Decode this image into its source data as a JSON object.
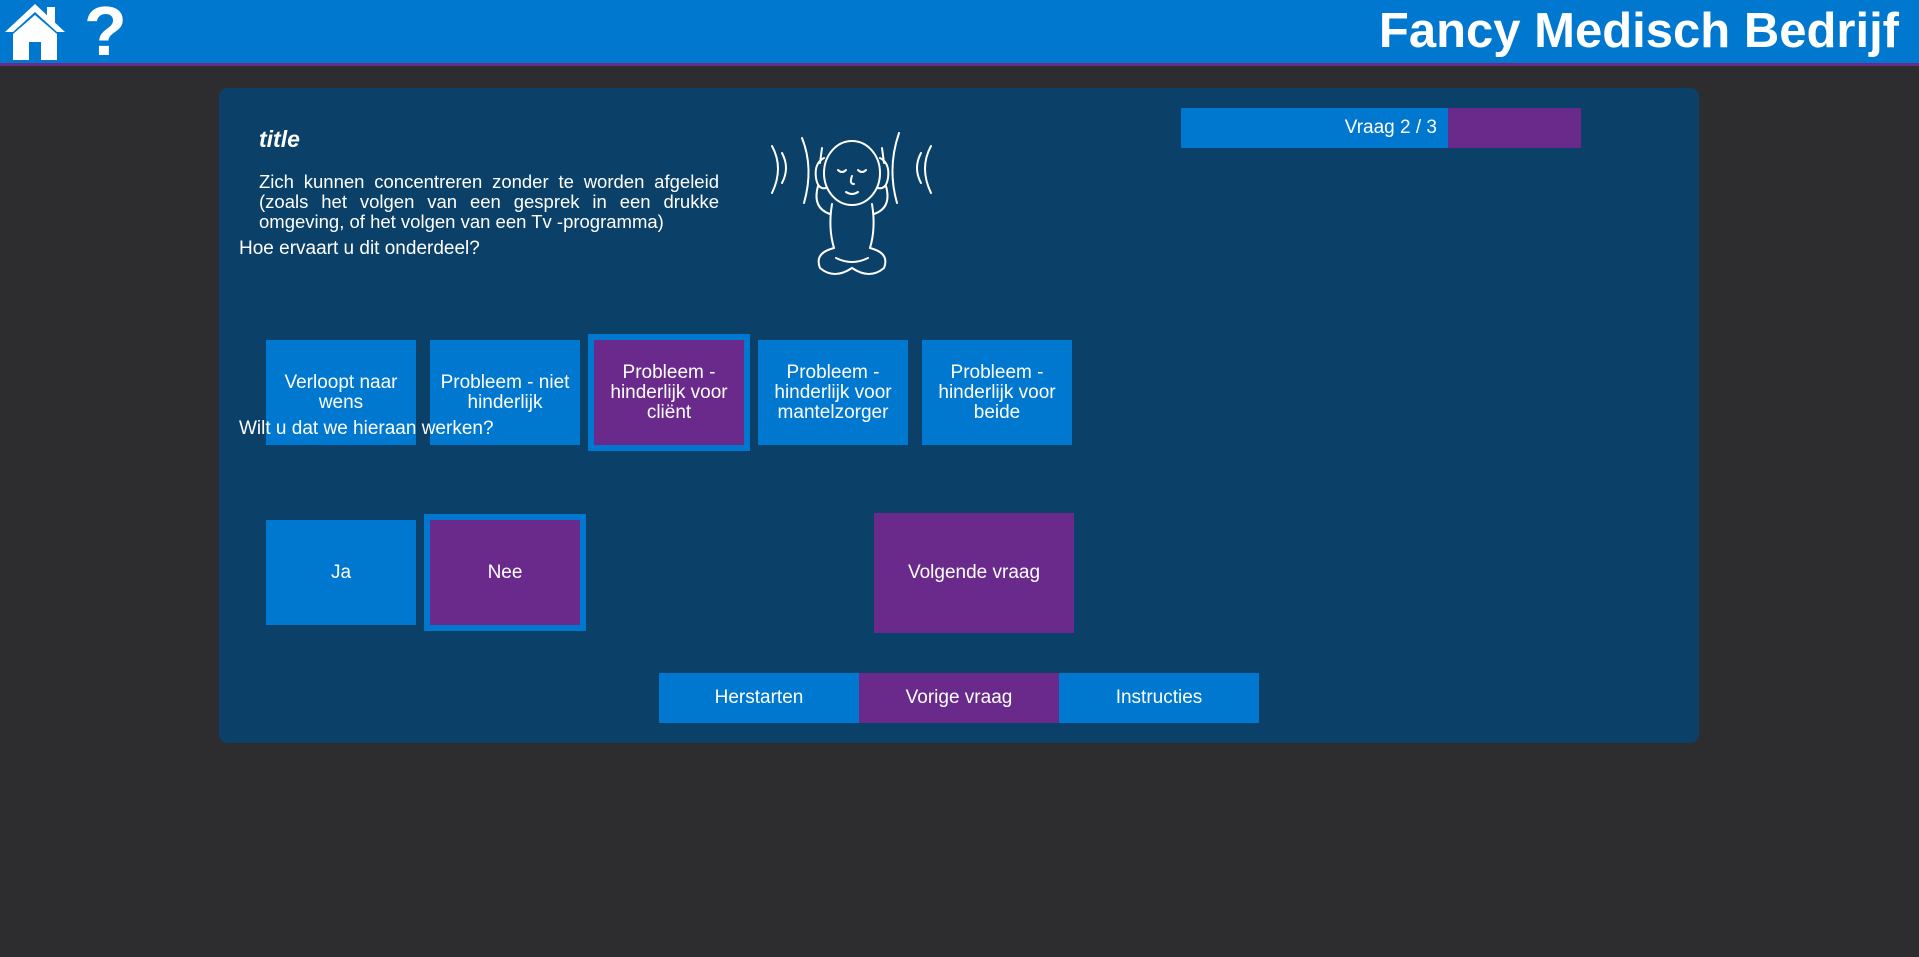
{
  "header": {
    "brand": "Fancy Medisch Bedrijf",
    "help_glyph": "?",
    "home_icon": "home-icon",
    "help_icon": "question-mark-icon",
    "colors": {
      "bar": "#0078d0",
      "underline": "#6a2a8c"
    }
  },
  "progress": {
    "label": "Vraag 2 / 3",
    "current": 2,
    "total": 3,
    "fraction": 0.667
  },
  "question": {
    "title": "title",
    "description": "Zich kunnen concentreren zonder te worden afgeleid (zoals het volgen van een gesprek in een drukke omgeving, of het volgen van een Tv -programma)",
    "illustration": "person-covering-ears-illustration"
  },
  "experience": {
    "label": "Hoe ervaart u dit onderdeel?",
    "options": [
      {
        "label": "Verloopt naar wens",
        "selected": false
      },
      {
        "label": "Probleem - niet hinderlijk",
        "selected": false
      },
      {
        "label": "Probleem - hinderlijk voor cliënt",
        "selected": true
      },
      {
        "label": "Probleem - hinderlijk voor mantelzorger",
        "selected": false
      },
      {
        "label": "Probleem - hinderlijk voor beide",
        "selected": false
      }
    ]
  },
  "work_on": {
    "label": "Wilt u dat we hieraan werken?",
    "options": [
      {
        "label": "Ja",
        "selected": false
      },
      {
        "label": "Nee",
        "selected": true
      }
    ]
  },
  "next_button": "Volgende vraag",
  "bottom_nav": {
    "restart": "Herstarten",
    "previous": "Vorige vraag",
    "instructions": "Instructies"
  },
  "colors": {
    "background": "#2d2d2f",
    "card": "#0b4168",
    "primary": "#0078d0",
    "accent": "#6a2a8c"
  }
}
